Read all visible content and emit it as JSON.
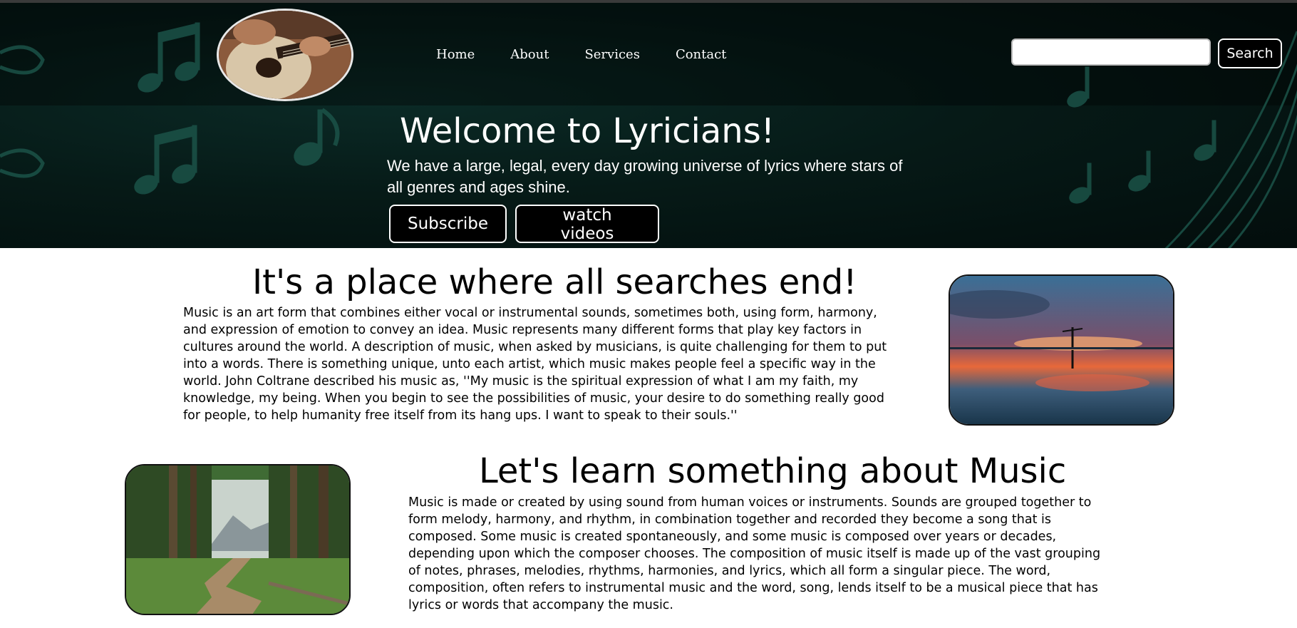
{
  "nav": {
    "items": [
      {
        "label": "Home"
      },
      {
        "label": "About"
      },
      {
        "label": "Services"
      },
      {
        "label": "Contact"
      }
    ]
  },
  "search": {
    "value": "",
    "placeholder": "",
    "button_label": "Search"
  },
  "hero": {
    "title": "Welcome to Lyricians!",
    "text": "We have a large, legal, every day growing universe of lyrics where stars of all genres and ages shine.",
    "subscribe_label": "Subscribe",
    "videos_label": "watch videos"
  },
  "section1": {
    "title": "It's a place where all searches end!",
    "text": "Music is an art form that combines either vocal or instrumental sounds, sometimes both, using form, harmony, and expression of emotion to convey an idea. Music represents many different forms that play key factors in cultures around the world. A description of music, when asked by musicians, is quite challenging for them to put into a words. There is something unique, unto each artist, which music makes people feel a specific way in the world. John Coltrane described his music as, ''My music is the spiritual expression of what I am my faith, my knowledge, my being. When you begin to see the possibilities of music, your desire to do something really good for people, to help humanity free itself from its hang ups. I want to speak to their souls.''"
  },
  "section2": {
    "title": "Let's learn something about Music",
    "text": "Music is made or created by using sound from human voices or instruments. Sounds are grouped together to form melody, harmony, and rhythm, in combination together and recorded they become a song that is composed. Some music is created spontaneously, and some music is composed over years or decades, depending upon which the composer chooses. The composition of music itself is made up of the vast grouping of notes, phrases, melodies, rhythms, harmonies, and lyrics, which all form a singular piece. The word, composition, often refers to instrumental music and the word, song, lends itself to be a musical piece that has lyrics or words that accompany the music."
  },
  "icons": {
    "logo": "guitar-player-logo",
    "background": "music-notes-icon",
    "photo1": "sunset-reflection-photo",
    "photo2": "forest-boardwalk-photo"
  },
  "colors": {
    "header_bg": "#061a17",
    "note_color": "#1f5a50",
    "button_bg": "#000000",
    "button_text": "#ffffff"
  }
}
